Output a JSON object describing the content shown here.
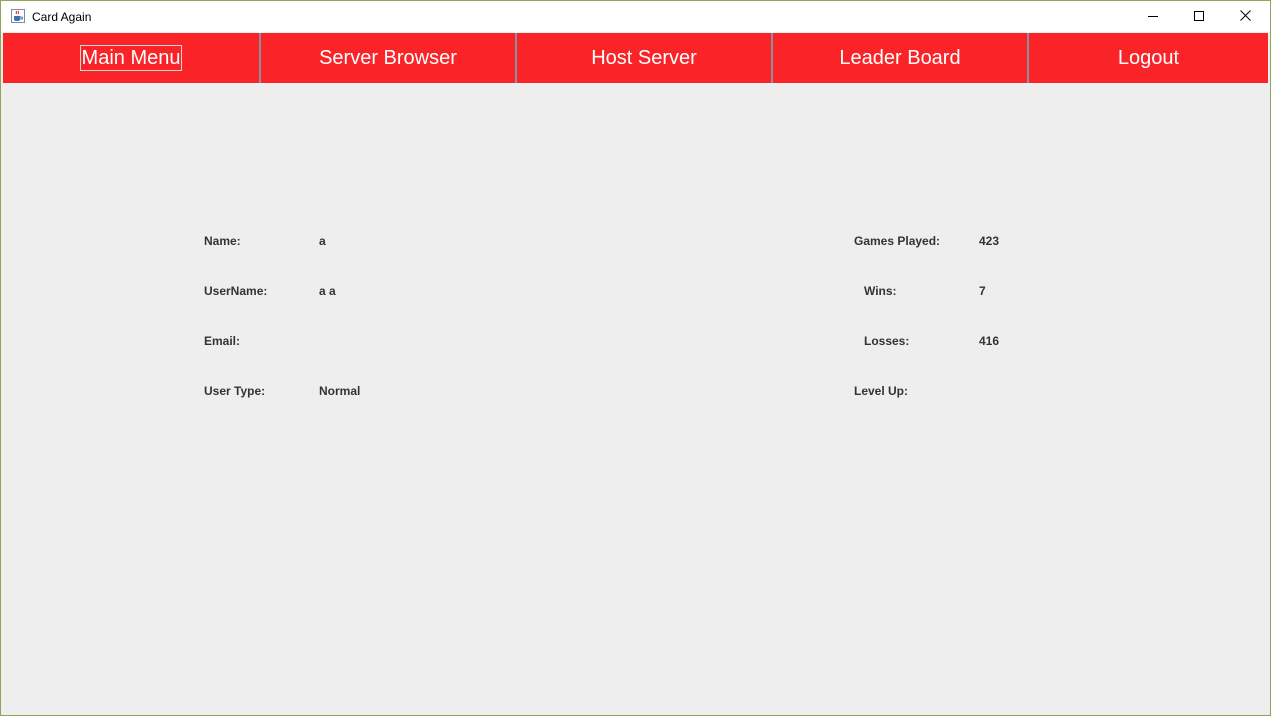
{
  "window": {
    "title": "Card Again",
    "app_icon": "java-cup-icon",
    "controls": {
      "minimize_icon": "minimize-icon",
      "maximize_icon": "maximize-icon",
      "close_icon": "close-icon"
    }
  },
  "nav": {
    "items": [
      {
        "label": "Main Menu"
      },
      {
        "label": "Server Browser"
      },
      {
        "label": "Host Server"
      },
      {
        "label": "Leader Board"
      },
      {
        "label": "Logout"
      }
    ],
    "selected": "Main Menu",
    "background_color": "#fa2328",
    "text_color": "#ffffff"
  },
  "profile": {
    "name_label": "Name:",
    "name_value": "a",
    "username_label": "UserName:",
    "username_value": "a a",
    "email_label": "Email:",
    "email_value": "",
    "usertype_label": "User Type:",
    "usertype_value": "Normal"
  },
  "stats": {
    "games_played_label": "Games Played:",
    "games_played_value": "423",
    "wins_label": "Wins:",
    "wins_value": "7",
    "losses_label": "Losses:",
    "losses_value": "416",
    "level_up_label": "Level Up:",
    "level_up_value": ""
  },
  "colors": {
    "content_background": "#eeeeee",
    "label_text": "#333333"
  }
}
